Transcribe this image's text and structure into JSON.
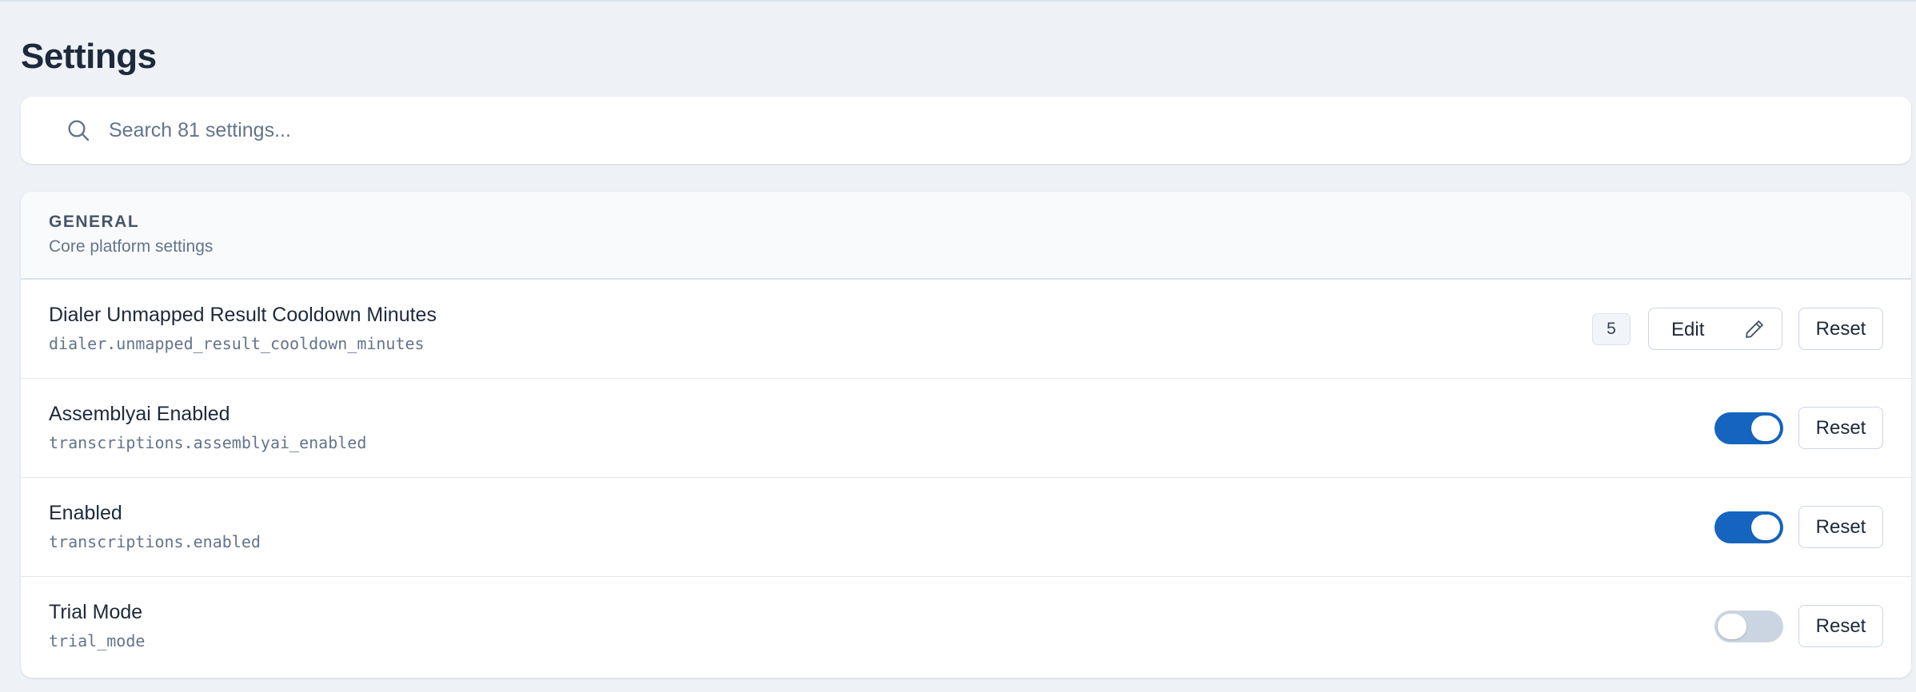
{
  "page": {
    "title": "Settings"
  },
  "search": {
    "placeholder": "Search 81 settings..."
  },
  "section": {
    "title": "GENERAL",
    "description": "Core platform settings"
  },
  "settings": [
    {
      "name": "Dialer Unmapped Result Cooldown Minutes",
      "key": "dialer.unmapped_result_cooldown_minutes",
      "type": "number",
      "value": "5",
      "edit_label": "Edit",
      "reset_label": "Reset"
    },
    {
      "name": "Assemblyai Enabled",
      "key": "transcriptions.assemblyai_enabled",
      "type": "boolean",
      "enabled": true,
      "reset_label": "Reset"
    },
    {
      "name": "Enabled",
      "key": "transcriptions.enabled",
      "type": "boolean",
      "enabled": true,
      "reset_label": "Reset"
    },
    {
      "name": "Trial Mode",
      "key": "trial_mode",
      "type": "boolean",
      "enabled": false,
      "reset_label": "Reset"
    }
  ],
  "colors": {
    "toggle_on": "#1565c0",
    "toggle_off": "#cbd5e1",
    "background": "#eef2f7"
  }
}
